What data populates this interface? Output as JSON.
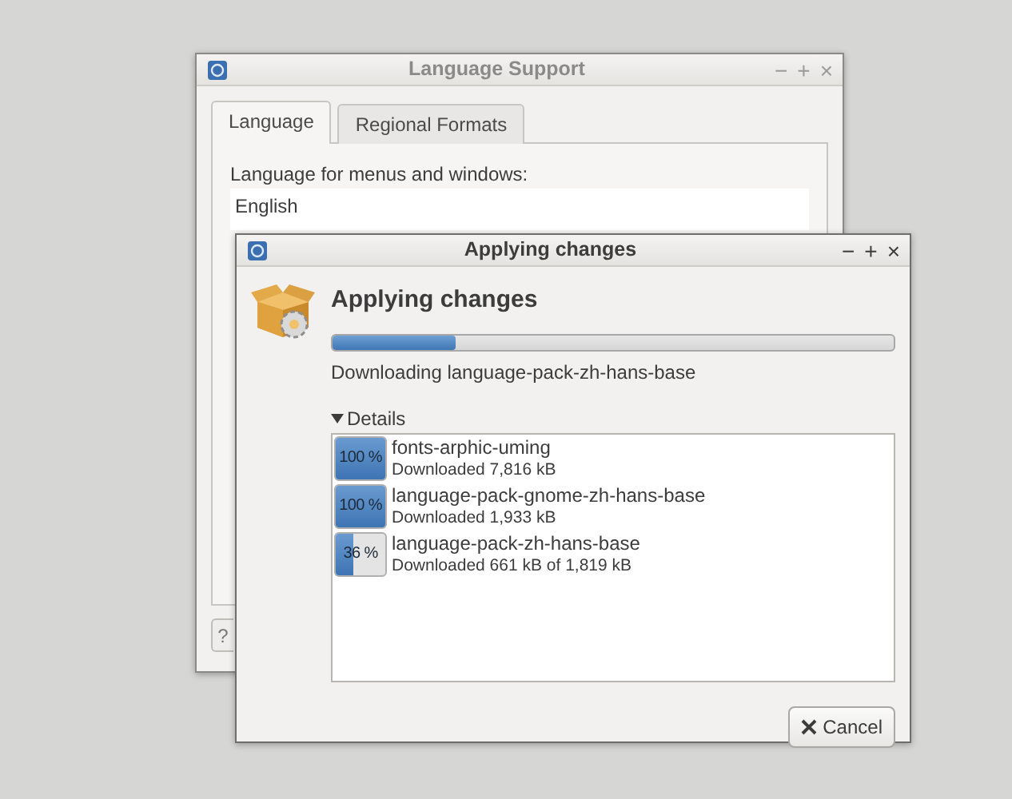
{
  "background_window": {
    "title": "Language Support",
    "controls": [
      "−",
      "+",
      "×"
    ],
    "tabs": [
      {
        "label": "Language",
        "selected": true
      },
      {
        "label": "Regional Formats",
        "selected": false
      }
    ],
    "language_label": "Language for menus and windows:",
    "languages": [
      "English"
    ],
    "help_button": "?"
  },
  "dialog": {
    "title": "Applying changes",
    "controls": [
      "−",
      "+",
      "×"
    ],
    "heading": "Applying changes",
    "progress": {
      "level": 0.22
    },
    "status": "Downloading language-pack-zh-hans-base",
    "details": {
      "label": "Details",
      "expanded": true,
      "items": [
        {
          "percent": "100 %",
          "level": 1,
          "name": "fonts-arphic-uming",
          "info": "Downloaded 7,816 kB"
        },
        {
          "percent": "100 %",
          "level": 1,
          "name": "language-pack-gnome-zh-hans-base",
          "info": "Downloaded 1,933 kB"
        },
        {
          "percent": "36 %",
          "level": 0.36,
          "name": "language-pack-zh-hans-base",
          "info": "Downloaded 661 kB of 1,819 kB"
        }
      ]
    },
    "cancel_button": "Cancel"
  }
}
